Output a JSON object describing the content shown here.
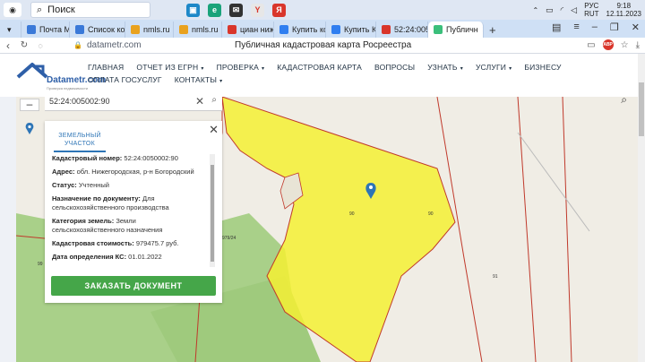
{
  "taskbar": {
    "search_label": "Поиск",
    "tray_lang_1": "РУС",
    "tray_lang_2": "RUT",
    "clock_time": "9:18",
    "clock_date": "12.11.2023"
  },
  "tabs": [
    {
      "label": "Почта Mai",
      "color": "#3a79d8"
    },
    {
      "label": "Список ко",
      "color": "#3a79d8"
    },
    {
      "label": "nmls.ru",
      "color": "#e9a21f"
    },
    {
      "label": "nmls.ru",
      "color": "#e9a21f"
    },
    {
      "label": "циан нижн",
      "color": "#d9362b"
    },
    {
      "label": "Купить ко",
      "color": "#2f7ef0"
    },
    {
      "label": "Купить Ка",
      "color": "#2f7ef0"
    },
    {
      "label": "52:24:005",
      "color": "#d9362b"
    },
    {
      "label": "Публичн",
      "color": "#3bbf7b"
    }
  ],
  "address": {
    "url": "datametr.com",
    "page_title": "Публичная кадастровая карта Росреестра"
  },
  "site": {
    "logo_text": "Datametr.com",
    "logo_sub": "Проверка недвижимости",
    "menu": [
      {
        "label": "ГЛАВНАЯ",
        "dropdown": false
      },
      {
        "label": "ОТЧЕТ ИЗ ЕГРН",
        "dropdown": true
      },
      {
        "label": "ПРОВЕРКА",
        "dropdown": true
      },
      {
        "label": "КАДАСТРОВАЯ КАРТА",
        "dropdown": false
      },
      {
        "label": "ВОПРОСЫ",
        "dropdown": false
      },
      {
        "label": "УЗНАТЬ",
        "dropdown": true
      },
      {
        "label": "УСЛУГИ",
        "dropdown": true
      },
      {
        "label": "БИЗНЕСУ",
        "dropdown": false
      },
      {
        "label": "ОПЛАТА ГОСУСЛУГ",
        "dropdown": false
      },
      {
        "label": "КОНТАКТЫ",
        "dropdown": true
      }
    ]
  },
  "map": {
    "search_value": "52:24:005002:90",
    "labels": [
      "90",
      "90",
      "979/24",
      "91",
      "99"
    ]
  },
  "panel": {
    "tab_label": "ЗЕМЕЛЬНЫЙ УЧАСТОК",
    "rows": [
      {
        "key": "Кадастровый номер:",
        "value": "52:24:0050002:90"
      },
      {
        "key": "Адрес:",
        "value": "обл. Нижегородская, р-н Богородский"
      },
      {
        "key": "Статус:",
        "value": "Учтенный"
      },
      {
        "key": "Назначение по документу:",
        "value": "Для сельскохозяйственного производства"
      },
      {
        "key": "Категория земель:",
        "value": "Земли сельскохозяйственного назначения"
      },
      {
        "key": "Кадастровая стоимость:",
        "value": "979475.7 руб."
      },
      {
        "key": "Дата определения КС:",
        "value": "01.01.2022"
      }
    ],
    "order_button": "ЗАКАЗАТЬ ДОКУМЕНТ"
  },
  "colors": {
    "parcel_fill": "#f5f034",
    "forest": "#a9d089",
    "boundary": "#c0392b",
    "button": "#45a649",
    "accent": "#2e75b6"
  }
}
